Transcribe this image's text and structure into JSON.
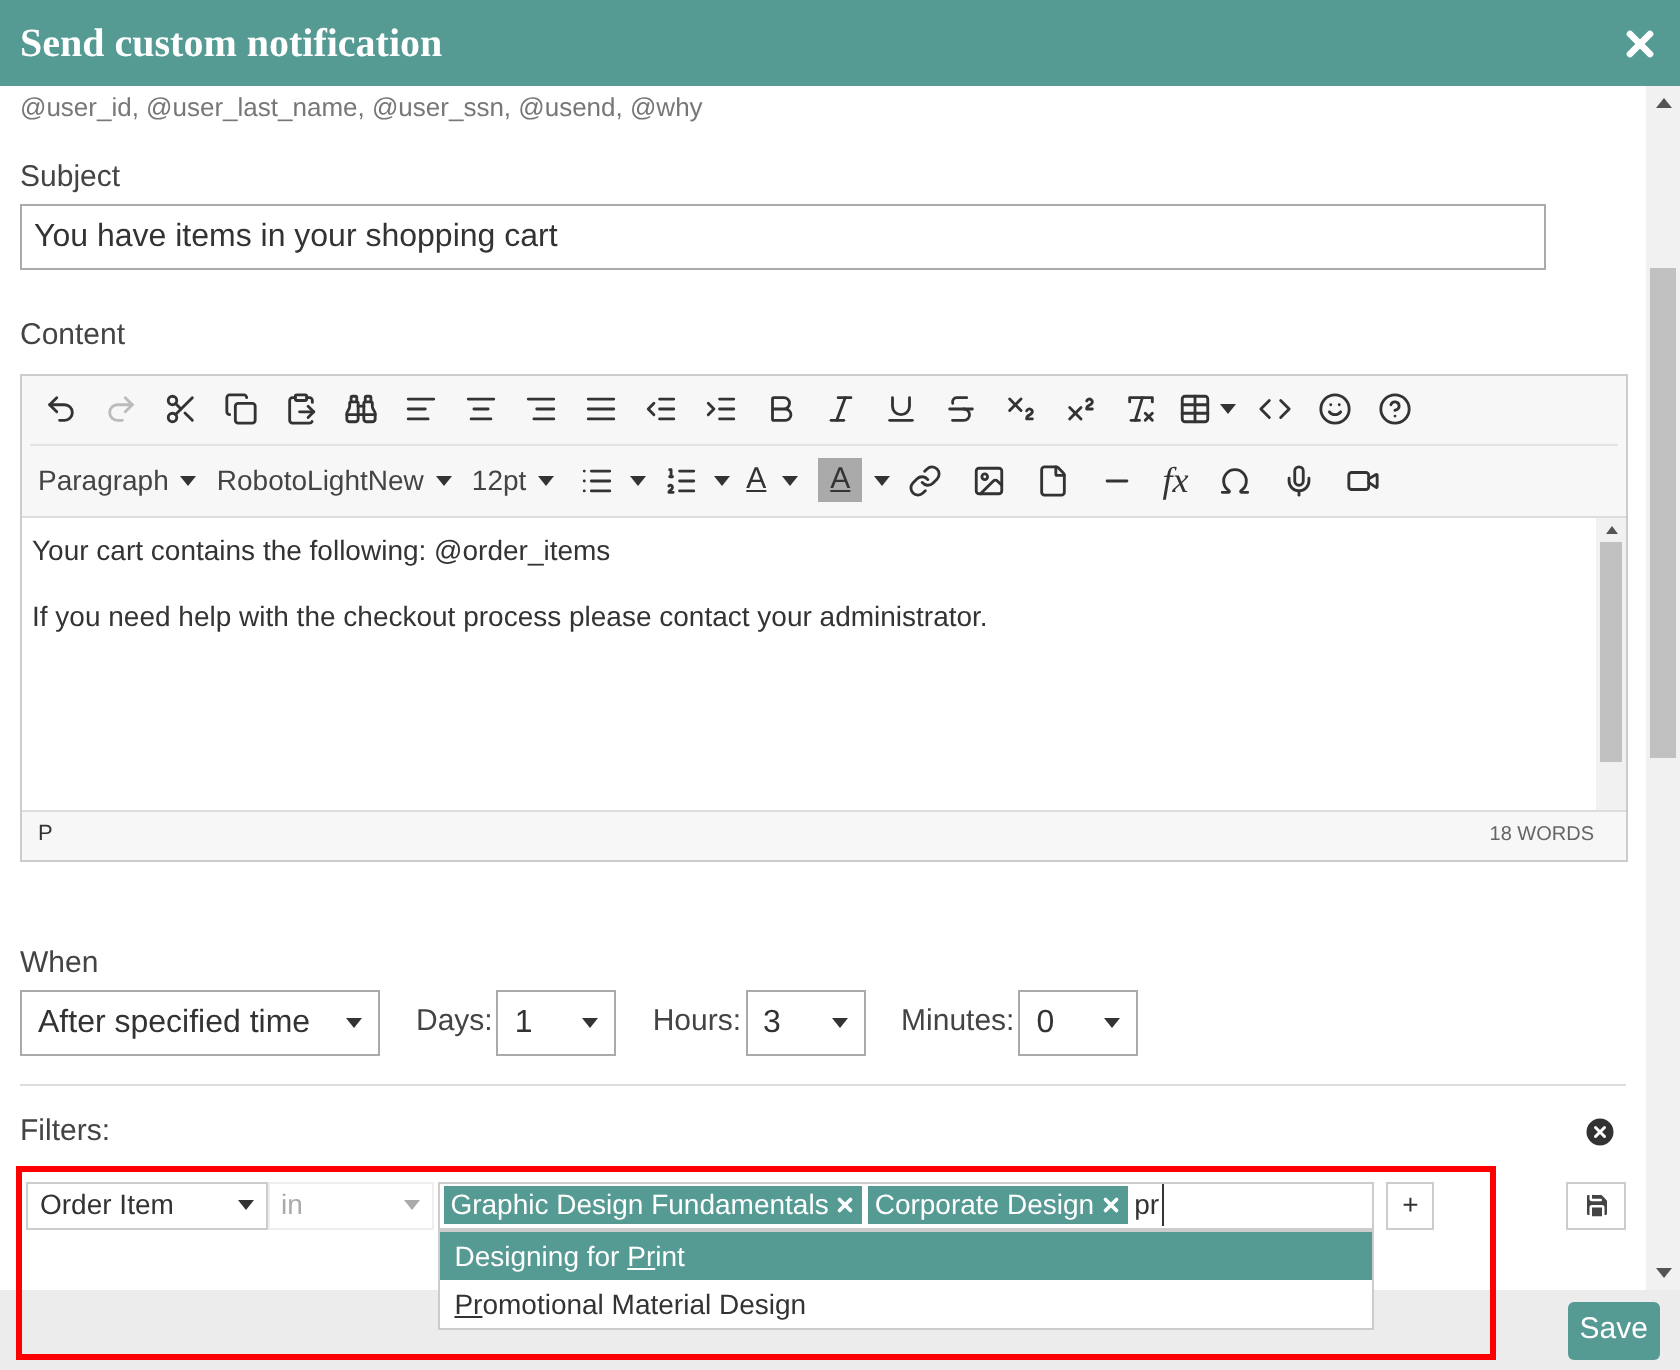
{
  "dialog": {
    "title": "Send custom notification",
    "variables_line": "@user_id, @user_last_name, @user_ssn, @usend, @why"
  },
  "subject": {
    "label": "Subject",
    "value": "You have items in your shopping cart"
  },
  "content": {
    "label": "Content",
    "format_menus": [
      "Paragraph",
      "RobotoLightNew",
      "12pt"
    ],
    "text_color_letter": "A",
    "highlight_letter": "A",
    "formula_label": "fx",
    "paragraphs": [
      "Your cart contains the following: @order_items",
      "If you need help with the checkout process please contact your administrator."
    ],
    "path": "P",
    "word_count": "18 WORDS"
  },
  "when": {
    "label": "When",
    "value": "After specified time",
    "fields": [
      {
        "label": "Days:",
        "value": "1"
      },
      {
        "label": "Hours:",
        "value": "3"
      },
      {
        "label": "Minutes:",
        "value": "0"
      }
    ]
  },
  "filters": {
    "label": "Filters:",
    "field": "Order Item",
    "operator": "in",
    "operator_disabled": true,
    "tags": [
      "Graphic Design Fundamentals",
      "Corporate Design"
    ],
    "typed": "pr",
    "suggestions": [
      {
        "before": "Designing for ",
        "match": "Pr",
        "after": "int",
        "selected": true
      },
      {
        "match": "Pr",
        "after": "omotional Material Design",
        "selected": false
      }
    ],
    "add_label": "+"
  },
  "footer": {
    "save": "Save"
  }
}
